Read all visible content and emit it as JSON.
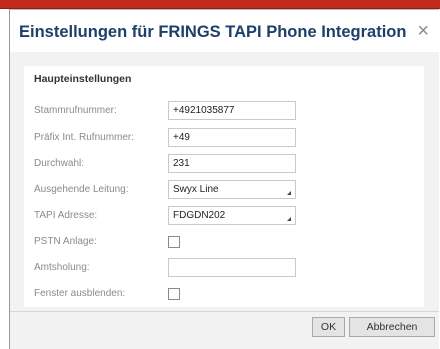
{
  "dialog": {
    "title": "Einstellungen für FRINGS TAPI Phone Integration",
    "close_glyph": "×",
    "close_icon": "close-icon"
  },
  "section": {
    "title": "Haupteinstellungen"
  },
  "fields": {
    "stammrufnummer": {
      "label": "Stammrufnummer:",
      "value": "+4921035877"
    },
    "praefix": {
      "label": "Präfix Int. Rufnummer:",
      "value": "+49"
    },
    "durchwahl": {
      "label": "Durchwahl:",
      "value": "231"
    },
    "ausgehende_leitung": {
      "label": "Ausgehende Leitung:",
      "value": "Swyx Line"
    },
    "tapi_adresse": {
      "label": "TAPI Adresse:",
      "value": "FDGDN202"
    },
    "pstn_anlage": {
      "label": "PSTN Anlage:",
      "checked": false
    },
    "amtsholung": {
      "label": "Amtsholung:",
      "value": ""
    },
    "fenster_ausblenden": {
      "label": "Fenster ausblenden:",
      "checked": false
    }
  },
  "buttons": {
    "ok": "OK",
    "cancel": "Abbrechen"
  },
  "colors": {
    "title": "#1f3f6b",
    "top_strip": "#c42a1c"
  }
}
